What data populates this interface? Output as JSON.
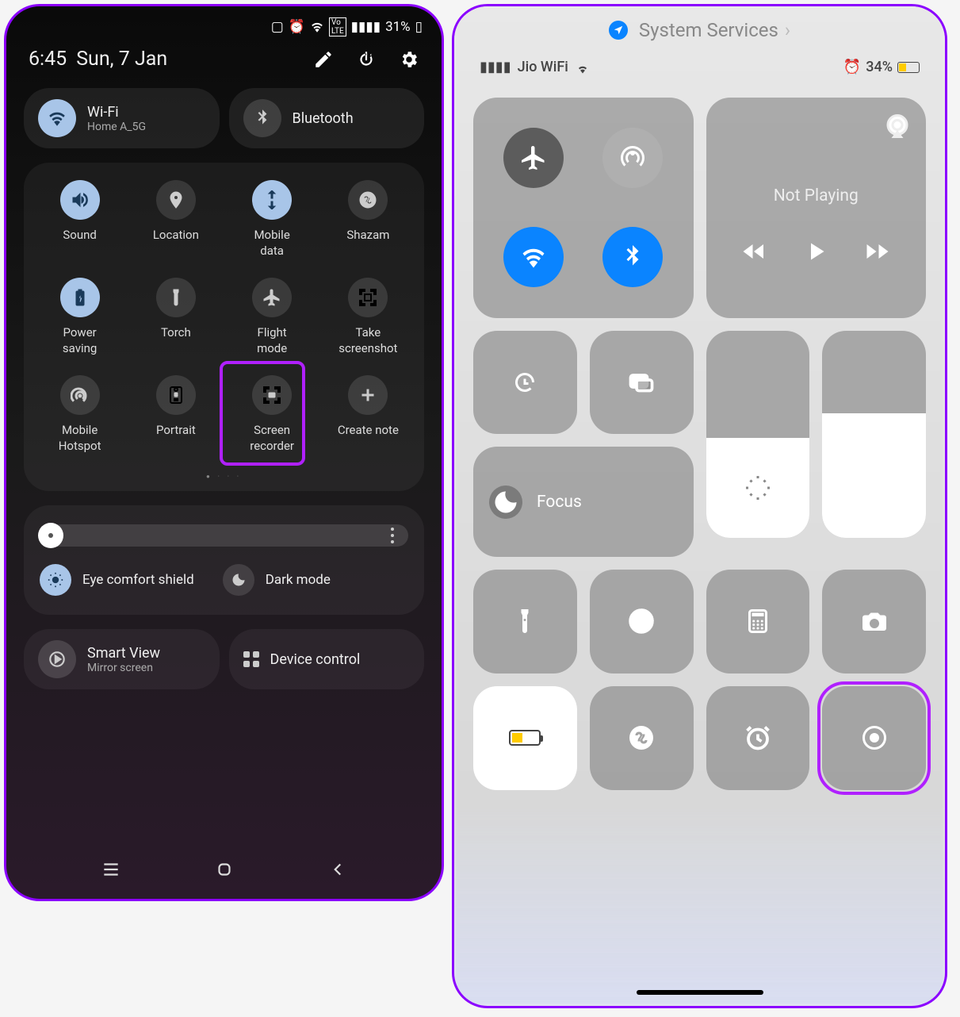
{
  "android": {
    "status": {
      "battery_pct": "31%"
    },
    "header": {
      "time": "6:45",
      "date": "Sun, 7 Jan"
    },
    "quickrow": {
      "wifi": {
        "title": "Wi-Fi",
        "subtitle": "Home A_5G"
      },
      "bluetooth": {
        "title": "Bluetooth"
      }
    },
    "tiles": [
      {
        "label": "Sound",
        "on": true
      },
      {
        "label": "Location",
        "on": false
      },
      {
        "label": "Mobile\ndata",
        "on": true
      },
      {
        "label": "Shazam",
        "on": false
      },
      {
        "label": "Power\nsaving",
        "on": true
      },
      {
        "label": "Torch",
        "on": false
      },
      {
        "label": "Flight\nmode",
        "on": false
      },
      {
        "label": "Take\nscreenshot",
        "on": false
      },
      {
        "label": "Mobile\nHotspot",
        "on": false
      },
      {
        "label": "Portrait",
        "on": false
      },
      {
        "label": "Screen\nrecorder",
        "on": false,
        "highlight": true
      },
      {
        "label": "Create note",
        "on": false
      }
    ],
    "comfort": {
      "eye": "Eye comfort shield",
      "dark": "Dark mode"
    },
    "bottom": {
      "smartview": {
        "title": "Smart View",
        "subtitle": "Mirror screen"
      },
      "device": {
        "title": "Device control"
      }
    }
  },
  "ios": {
    "breadcrumb": "System Services",
    "status": {
      "carrier": "Jio WiFi",
      "battery_pct": "34%"
    },
    "media": {
      "title": "Not Playing"
    },
    "focus": {
      "label": "Focus"
    },
    "brightness_pct": 48,
    "volume_pct": 60,
    "highlight_tile": "screen-record"
  }
}
